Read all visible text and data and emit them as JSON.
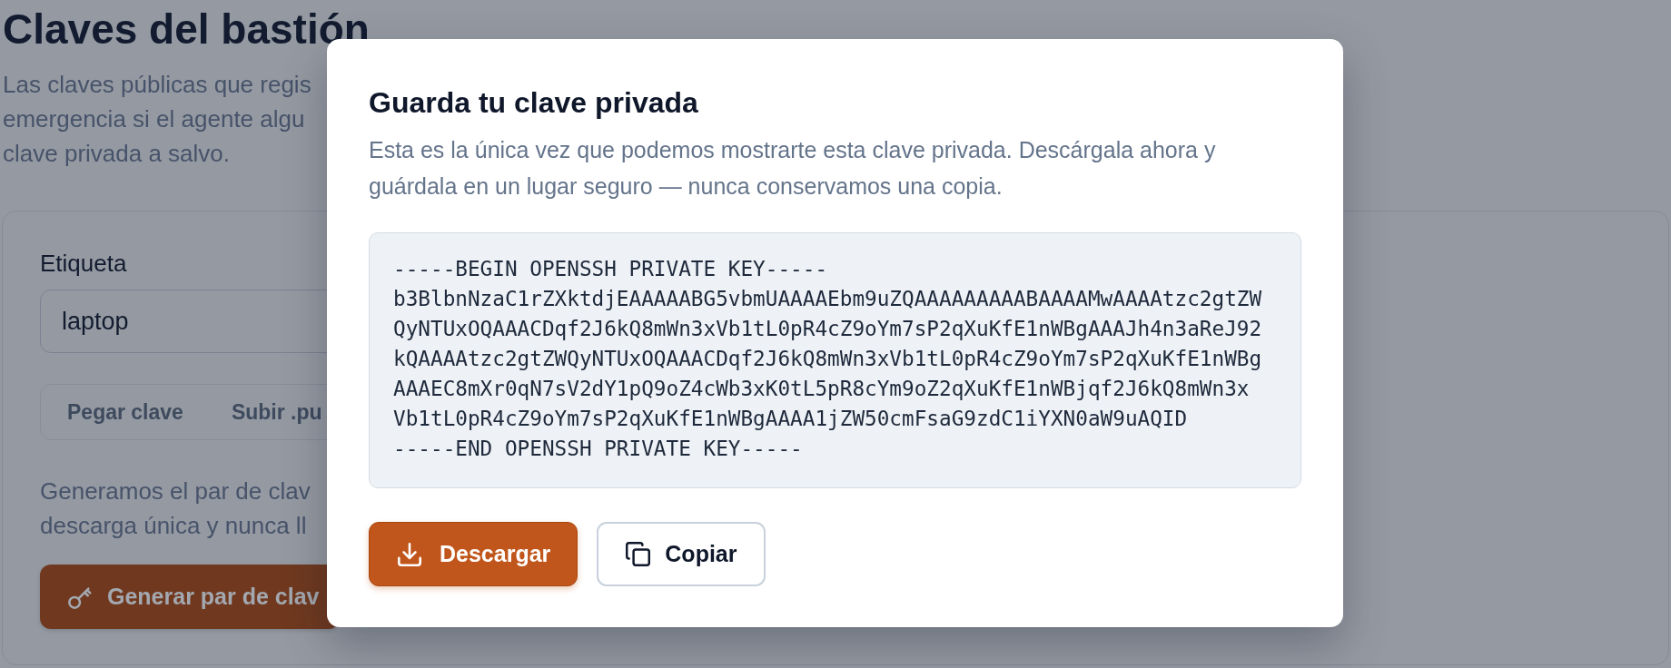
{
  "page": {
    "title": "Claves del bastión",
    "intro_lines": [
      "Las claves públicas que regis",
      "emergencia si el agente algu",
      "clave privada a salvo."
    ]
  },
  "form": {
    "label": "Etiqueta",
    "input": {
      "value": "laptop"
    },
    "tabs": [
      {
        "label": "Pegar clave",
        "selected": false
      },
      {
        "label": "Subir .pu",
        "selected": false
      }
    ],
    "note_lines": [
      "Generamos el par de clav",
      "descarga única y nunca ll"
    ],
    "generate_button": {
      "label": "Generar par de clav"
    }
  },
  "dialog": {
    "title": "Guarda tu clave privada",
    "description": "Esta es la única vez que podemos mostrarte esta clave privada. Descárgala ahora y guárdala en un lugar seguro — nunca conservamos una copia.",
    "private_key": [
      "-----BEGIN OPENSSH PRIVATE KEY-----",
      "b3BlbnNzaC1rZXktdjEAAAAABG5vbmUAAAAEbm9uZQAAAAAAAAABAAAAMwAAAAtzc2gtZW",
      "QyNTUxOQAAACDqf2J6kQ8mWn3xVb1tL0pR4cZ9oYm7sP2qXuKfE1nWBgAAAJh4n3aReJ92",
      "kQAAAAtzc2gtZWQyNTUxOQAAACDqf2J6kQ8mWn3xVb1tL0pR4cZ9oYm7sP2qXuKfE1nWBg",
      "AAAEC8mXr0qN7sV2dY1pQ9oZ4cWb3xK0tL5pR8cYm9oZ2qXuKfE1nWBjqf2J6kQ8mWn3x",
      "Vb1tL0pR4cZ9oYm7sP2qXuKfE1nWBgAAAA1jZW50cmFsaG9zdC1iYXN0aW9uAQID",
      "-----END OPENSSH PRIVATE KEY-----"
    ],
    "buttons": [
      {
        "label": "Descargar",
        "kind": "download"
      },
      {
        "label": "Copiar",
        "kind": "copy"
      }
    ]
  }
}
